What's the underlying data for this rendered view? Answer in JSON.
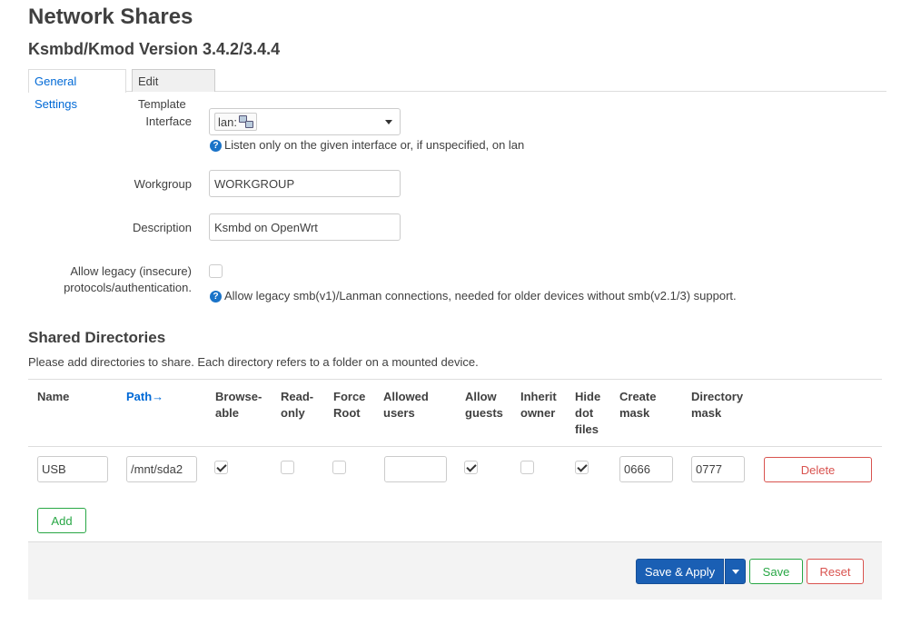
{
  "page": {
    "title": "Network Shares",
    "subtitle": "Ksmbd/Kmod Version 3.4.2/3.4.4"
  },
  "tabs": [
    {
      "label": "General Settings",
      "active": true
    },
    {
      "label": "Edit Template",
      "active": false
    }
  ],
  "general": {
    "interface": {
      "label": "Interface",
      "value": "lan:",
      "icon": "network-interface-icon",
      "help": "Listen only on the given interface or, if unspecified, on lan"
    },
    "workgroup": {
      "label": "Workgroup",
      "value": "WORKGROUP"
    },
    "description": {
      "label": "Description",
      "value": "Ksmbd on OpenWrt"
    },
    "legacy": {
      "label_line1": "Allow legacy (insecure)",
      "label_line2": "protocols/authentication.",
      "checked": false,
      "help": "Allow legacy smb(v1)/Lanman connections, needed for older devices without smb(v2.1/3) support."
    }
  },
  "shares": {
    "title": "Shared Directories",
    "description": "Please add directories to share. Each directory refers to a folder on a mounted device.",
    "columns": {
      "name": "Name",
      "path": "Path",
      "path_arrow": "→",
      "browseable": [
        "Browse-",
        "able"
      ],
      "read_only": [
        "Read-",
        "only"
      ],
      "force_root": [
        "Force",
        "Root"
      ],
      "allowed_users": [
        "Allowed",
        "users"
      ],
      "allow_guests": [
        "Allow",
        "guests"
      ],
      "inherit_owner": [
        "Inherit",
        "owner"
      ],
      "hide_dot_files": [
        "Hide",
        "dot",
        "files"
      ],
      "create_mask": [
        "Create",
        "mask"
      ],
      "directory_mask": [
        "Directory",
        "mask"
      ]
    },
    "rows": [
      {
        "name": "USB",
        "path": "/mnt/sda2",
        "browseable": true,
        "read_only": false,
        "force_root": false,
        "allowed_users": "",
        "allow_guests": true,
        "inherit_owner": false,
        "hide_dot_files": true,
        "create_mask": "0666",
        "directory_mask": "0777",
        "delete_label": "Delete"
      }
    ],
    "add_label": "Add"
  },
  "footer": {
    "save_apply": "Save & Apply",
    "save": "Save",
    "reset": "Reset"
  },
  "colors": {
    "primary": "#1a5fb4",
    "success": "#28a745",
    "danger": "#d9534f",
    "link": "#0069d6"
  }
}
